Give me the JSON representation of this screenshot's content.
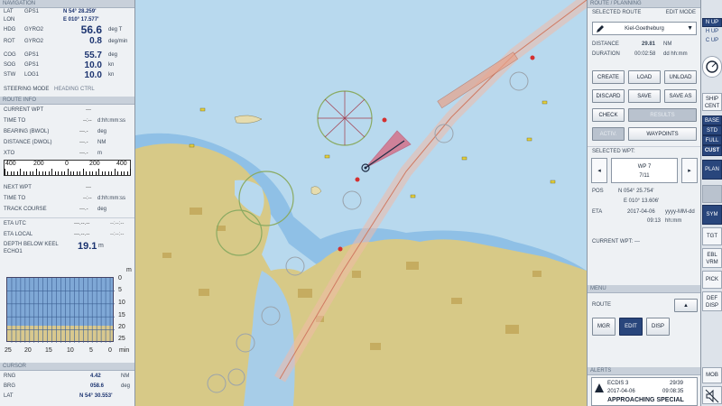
{
  "navigation": {
    "title": "NAVIGATION",
    "lat": {
      "label": "LAT",
      "src": "GPS1",
      "value": "N 54° 28.259'"
    },
    "lon": {
      "label": "LON",
      "value": "E 010° 17.577'"
    },
    "hdg": {
      "label": "HDG",
      "src": "GYRO2",
      "value": "56.6",
      "unit": "deg T"
    },
    "rot": {
      "label": "ROT",
      "src": "GYRO2",
      "value": "0.8",
      "unit": "deg/min"
    },
    "cog": {
      "label": "COG",
      "src": "GPS1",
      "value": "55.7",
      "unit": "deg"
    },
    "sog": {
      "label": "SOG",
      "src": "GPS1",
      "value": "10.0",
      "unit": "kn"
    },
    "stw": {
      "label": "STW",
      "src": "LOG1",
      "value": "10.0",
      "unit": "kn"
    },
    "steering": {
      "label": "STEERING MODE",
      "value": "HEADING CTRL"
    }
  },
  "route_info": {
    "title": "ROUTE INFO",
    "current_wpt": {
      "label": "CURRENT WPT",
      "value": "---"
    },
    "time_to": {
      "label": "TIME TO",
      "value": "--:--",
      "unit": "d:hh:mm:ss"
    },
    "bearing": {
      "label": "BEARING (BWOL)",
      "value": "---.-",
      "unit": "deg"
    },
    "distance": {
      "label": "DISTANCE (DWOL)",
      "value": "---.-",
      "unit": "NM"
    },
    "xto": {
      "label": "XTO",
      "value": "---.-",
      "unit": "m"
    },
    "scale": {
      "labels": [
        "400",
        "200",
        "0",
        "200",
        "400"
      ]
    },
    "next_wpt": {
      "label": "NEXT WPT",
      "value": "---"
    },
    "time_to2": {
      "label": "TIME TO",
      "value": "--:--",
      "unit": "d:hh:mm:ss"
    },
    "track_course": {
      "label": "TRACK COURSE",
      "value": "---.-",
      "unit": "deg"
    },
    "eta_utc": {
      "label": "ETA UTC",
      "value": "---.--.--",
      "value2": "--:--:--"
    },
    "eta_local": {
      "label": "ETA LOCAL",
      "value": "---.--.--",
      "value2": "--:--:--"
    }
  },
  "depth": {
    "label": "DEPTH BELOW KEEL",
    "src": "ECHO1",
    "value": "19.1",
    "unit": "m",
    "level_fraction": 0.76,
    "y_ticks": [
      "0",
      "5",
      "10",
      "15",
      "20",
      "25"
    ],
    "y_unit": "m",
    "x_ticks": [
      "25",
      "20",
      "15",
      "10",
      "5",
      "0"
    ],
    "x_unit": "min"
  },
  "cursor": {
    "title": "CURSOR",
    "rng": {
      "label": "RNG",
      "value": "4.42",
      "unit": "NM"
    },
    "brg": {
      "label": "BRG",
      "value": "058.6",
      "unit": "deg"
    },
    "lat": {
      "label": "LAT",
      "value": "N 54° 30.553'"
    }
  },
  "route_planning": {
    "title": "ROUTE / PLANNING",
    "selected_route_label": "SELECTED ROUTE",
    "mode": "EDIT MODE",
    "route_name": "Kiel-Goetheburg",
    "distance": {
      "label": "DISTANCE",
      "value": "29.81",
      "unit": "NM"
    },
    "duration": {
      "label": "DURATION",
      "value": "00:02:58",
      "unit": "dd hh:mm"
    },
    "buttons": {
      "create": "CREATE",
      "load": "LOAD",
      "unload": "UNLOAD",
      "discard": "DISCARD",
      "save": "SAVE",
      "save_as": "SAVE AS",
      "check": "CHECK",
      "results": "RESULTS",
      "activ": "ACTIV.",
      "waypoints": "WAYPOINTS"
    },
    "selected_wpt_label": "SELECTED WPT:",
    "wpt": {
      "name": "WP 7",
      "index": "7/11"
    },
    "pos": {
      "label": "POS",
      "lat": "N 054° 25.754'",
      "lon": "E 010° 13.606'"
    },
    "eta": {
      "label": "ETA",
      "date": "2017-04-06",
      "date_fmt": "yyyy-MM-dd",
      "time": "09:13",
      "time_fmt": "hh:mm"
    },
    "current_wpt_label": "CURRENT WPT:",
    "current_wpt_value": "---"
  },
  "menu": {
    "title": "MENU",
    "route_label": "ROUTE",
    "mgr": "MGR",
    "edit": "EDIT",
    "disp": "DISP"
  },
  "alerts": {
    "title": "ALERTS",
    "source": "ECDIS 3",
    "count": "29/39",
    "date": "2017-04-06",
    "time": "09:08:35",
    "message": "APPROACHING SPECIAL"
  },
  "toolbar": {
    "n_up": "N UP",
    "h_up": "H UP",
    "c_up": "C UP",
    "ship_cent": [
      "SHIP",
      "CENT"
    ],
    "base": "BASE",
    "std": "STD",
    "full": "FULL",
    "cust": "CUST",
    "plan": "PLAN",
    "sym": "SYM",
    "tgt": "TGT",
    "ebl_vrm": [
      "EBL",
      "VRM"
    ],
    "pick": "PICK",
    "def_disp": [
      "DEF",
      "DISP"
    ],
    "mob": "MOB"
  },
  "colors": {
    "sea": "#b8d9ee",
    "land": "#d7c987",
    "shallow": "#7fb2dd",
    "panel": "#eef1f4",
    "accent": "#29467c",
    "route": "#e8a28a",
    "own_ship": "#e23a55"
  }
}
